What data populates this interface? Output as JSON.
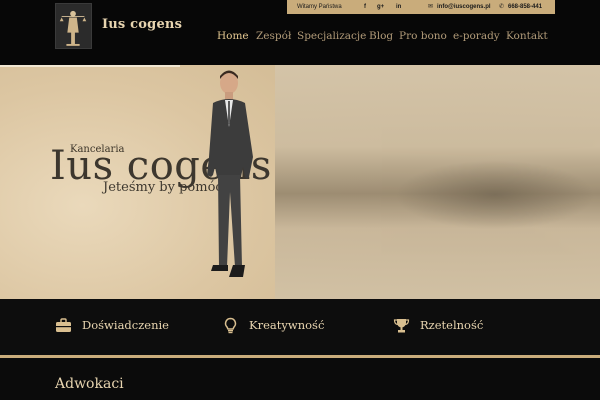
{
  "brand": {
    "name": "Ius cogens"
  },
  "topbar": {
    "greeting": "Witamy Państwa",
    "social": [
      "f",
      "g+",
      "in"
    ],
    "email": "info@iuscogens.pl",
    "phone": "668-858-441"
  },
  "nav": {
    "items": [
      "Home",
      "Zespół",
      "Specjalizacje",
      "Blog",
      "Pro bono",
      "e-porady",
      "Kontakt"
    ],
    "active": "Home"
  },
  "hero": {
    "subtitle": "Kancelaria",
    "title": "Ius cogens",
    "tagline": "Jeteśmy by pomóc"
  },
  "features": [
    {
      "icon": "briefcase-icon",
      "label": "Doświadczenie"
    },
    {
      "icon": "lightbulb-icon",
      "label": "Kreatywność"
    },
    {
      "icon": "trophy-icon",
      "label": "Rzetelność"
    }
  ],
  "section": {
    "title": "Adwokaci"
  },
  "colors": {
    "accent": "#c9ac7b",
    "background": "#0b0b0b",
    "text": "#e8d5b0"
  }
}
